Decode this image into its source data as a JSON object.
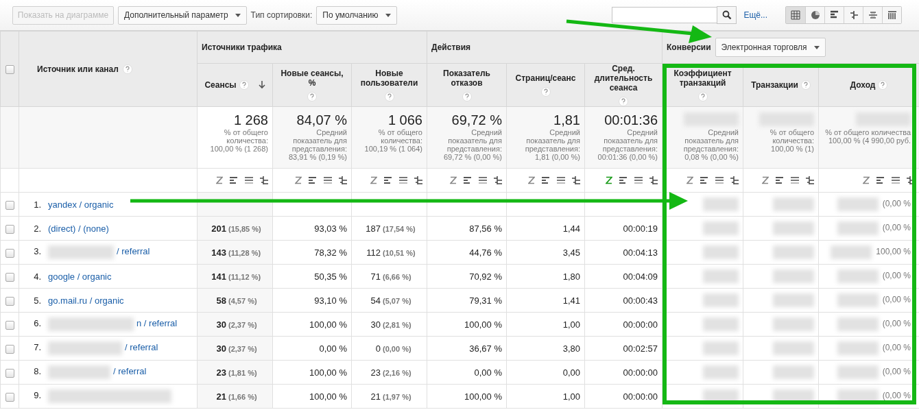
{
  "toolbar": {
    "chart_button": {
      "label": "Показать на диаграмме",
      "disabled": true
    },
    "secondary_dimension": "Дополнительный параметр",
    "sort_label": "Тип сортировки:",
    "sort_type": "По умолчанию",
    "more_link": "Ещё...",
    "views": [
      {
        "kind": "table",
        "selected": true
      },
      {
        "kind": "pie",
        "selected": false
      },
      {
        "kind": "bars",
        "selected": false
      },
      {
        "kind": "compare",
        "selected": false
      },
      {
        "kind": "pivot",
        "selected": false
      },
      {
        "kind": "columns",
        "selected": false
      }
    ]
  },
  "table": {
    "select_all_checked": false,
    "dimension_header": "Источник или канал",
    "groups": [
      {
        "label": "Источники трафика"
      },
      {
        "label": "Действия"
      },
      {
        "label": "Конверсии",
        "dropdown": "Электронная торговля"
      }
    ],
    "columns": [
      {
        "label": "Сеансы",
        "sorted": true
      },
      {
        "label": "Новые сеансы, %",
        "sorted": false
      },
      {
        "label": "Новые пользователи",
        "sorted": false
      },
      {
        "label": "Показатель отказов",
        "sorted": false
      },
      {
        "label": "Страниц/сеанс",
        "sorted": false
      },
      {
        "label": "Сред. длительность сеанса",
        "sorted": false
      },
      {
        "label": "Коэффициент транзакций",
        "sorted": false
      },
      {
        "label": "Транзакции",
        "sorted": false
      },
      {
        "label": "Доход",
        "sorted": false
      }
    ],
    "totals": [
      {
        "value": "1 268",
        "note": [
          "% от общего",
          "количества:",
          "100,00 % (1 268)"
        ]
      },
      {
        "value": "84,07 %",
        "note": [
          "Средний",
          "показатель для",
          "представления:",
          "83,91 % (0,19 %)"
        ]
      },
      {
        "value": "1 066",
        "note": [
          "% от общего",
          "количества:",
          "100,19 % (1 064)"
        ]
      },
      {
        "value": "69,72 %",
        "note": [
          "Средний",
          "показатель для",
          "представления:",
          "69,72 % (0,00 %)"
        ]
      },
      {
        "value": "1,81",
        "note": [
          "Средний",
          "показатель для",
          "представления:",
          "1,81 (0,00 %)"
        ]
      },
      {
        "value": "00:01:36",
        "note": [
          "Средний",
          "показатель для",
          "представления:",
          "00:01:36 (0,00 %)"
        ]
      },
      {
        "redacted": true,
        "note": [
          "Средний",
          "показатель для",
          "представления:",
          "0,08 % (0,00 %)"
        ]
      },
      {
        "redacted": true,
        "note": [
          "% от общего",
          "количества:",
          "100,00 % (1)"
        ]
      },
      {
        "redacted": true,
        "note": [
          "% от общего количества",
          "100,00 % (4 990,00 руб."
        ]
      }
    ],
    "tools": [
      {
        "weighted": false
      },
      {
        "weighted": false
      },
      {
        "weighted": false
      },
      {
        "weighted": false
      },
      {
        "weighted": false
      },
      {
        "weighted": true
      },
      {
        "weighted": false
      },
      {
        "weighted": false
      },
      {
        "weighted": false
      }
    ],
    "rows": [
      {
        "index": "1.",
        "source": "yandex / organic",
        "redacted": false,
        "checked": false,
        "revenue_pct": "(0,00 %"
      },
      {
        "index": "2.",
        "source": "(direct) / (none)",
        "redacted": false,
        "checked": false,
        "sessions": "201",
        "sessions_pct": "(15,85 %)",
        "new_sessions": "93,03 %",
        "new_users": "187",
        "new_users_pct": "(17,54 %)",
        "bounce": "87,56 %",
        "pages": "1,44",
        "duration": "00:00:19",
        "revenue_pct": "(0,00 %"
      },
      {
        "index": "3.",
        "source": "/ referral",
        "redacted": true,
        "checked": false,
        "sessions": "143",
        "sessions_pct": "(11,28 %)",
        "new_sessions": "78,32 %",
        "new_users": "112",
        "new_users_pct": "(10,51 %)",
        "bounce": "44,76 %",
        "pages": "3,45",
        "duration": "00:04:13",
        "revenue_pct": "100,00 %"
      },
      {
        "index": "4.",
        "source": "google / organic",
        "redacted": false,
        "checked": false,
        "sessions": "141",
        "sessions_pct": "(11,12 %)",
        "new_sessions": "50,35 %",
        "new_users": "71",
        "new_users_pct": "(6,66 %)",
        "bounce": "70,92 %",
        "pages": "1,80",
        "duration": "00:04:09",
        "revenue_pct": "(0,00 %"
      },
      {
        "index": "5.",
        "source": "go.mail.ru / organic",
        "redacted": false,
        "checked": false,
        "sessions": "58",
        "sessions_pct": "(4,57 %)",
        "new_sessions": "93,10 %",
        "new_users": "54",
        "new_users_pct": "(5,07 %)",
        "bounce": "79,31 %",
        "pages": "1,41",
        "duration": "00:00:43",
        "revenue_pct": "(0,00 %"
      },
      {
        "index": "6.",
        "source": "n / referral",
        "redacted": true,
        "checked": false,
        "sessions": "30",
        "sessions_pct": "(2,37 %)",
        "new_sessions": "100,00 %",
        "new_users": "30",
        "new_users_pct": "(2,81 %)",
        "bounce": "100,00 %",
        "pages": "1,00",
        "duration": "00:00:00",
        "revenue_pct": "(0,00 %"
      },
      {
        "index": "7.",
        "source": "/ referral",
        "redacted": true,
        "checked": false,
        "sessions": "30",
        "sessions_pct": "(2,37 %)",
        "new_sessions": "0,00 %",
        "new_users": "0",
        "new_users_pct": "(0,00 %)",
        "bounce": "36,67 %",
        "pages": "3,80",
        "duration": "00:02:57",
        "revenue_pct": "(0,00 %"
      },
      {
        "index": "8.",
        "source": "/ referral",
        "redacted": true,
        "checked": false,
        "sessions": "23",
        "sessions_pct": "(1,81 %)",
        "new_sessions": "100,00 %",
        "new_users": "23",
        "new_users_pct": "(2,16 %)",
        "bounce": "0,00 %",
        "pages": "0,00",
        "duration": "00:00:00",
        "revenue_pct": "(0,00 %"
      },
      {
        "index": "9.",
        "redacted": true,
        "checked": false,
        "sessions": "21",
        "sessions_pct": "(1,66 %)",
        "new_sessions": "100,00 %",
        "new_users": "21",
        "new_users_pct": "(1,97 %)",
        "bounce": "100,00 %",
        "pages": "1,00",
        "duration": "00:00:00",
        "revenue_pct": "(0,00 %"
      }
    ]
  }
}
